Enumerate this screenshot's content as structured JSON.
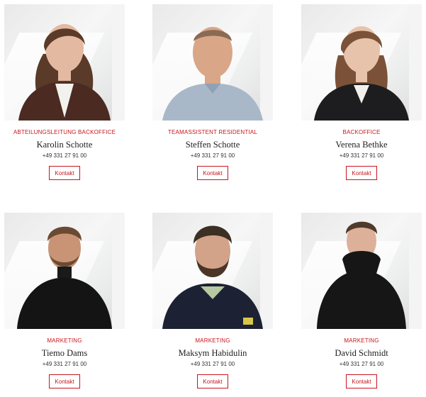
{
  "team": [
    {
      "role": "ABTEILUNGSLEITUNG BACKOFFICE",
      "name": "Karolin Schotte",
      "phone": "+49 331 27 91 00",
      "contact_label": "Kontakt"
    },
    {
      "role": "TEAMASSISTENT RESIDENTIAL",
      "name": "Steffen Schotte",
      "phone": "+49 331 27 91 00",
      "contact_label": "Kontakt"
    },
    {
      "role": "BACKOFFICE",
      "name": "Verena Bethke",
      "phone": "+49 331 27 91 00",
      "contact_label": "Kontakt"
    },
    {
      "role": "MARKETING",
      "name": "Tiemo Dams",
      "phone": "+49 331 27 91 00",
      "contact_label": "Kontakt"
    },
    {
      "role": "MARKETING",
      "name": "Maksym Habidulin",
      "phone": "+49 331 27 91 00",
      "contact_label": "Kontakt"
    },
    {
      "role": "MARKETING",
      "name": "David Schmidt",
      "phone": "+49 331 27 91 00",
      "contact_label": "Kontakt"
    }
  ],
  "colors": {
    "accent": "#c8161d",
    "text": "#1e1e1e"
  },
  "icons": [
    "portrait-photo"
  ]
}
